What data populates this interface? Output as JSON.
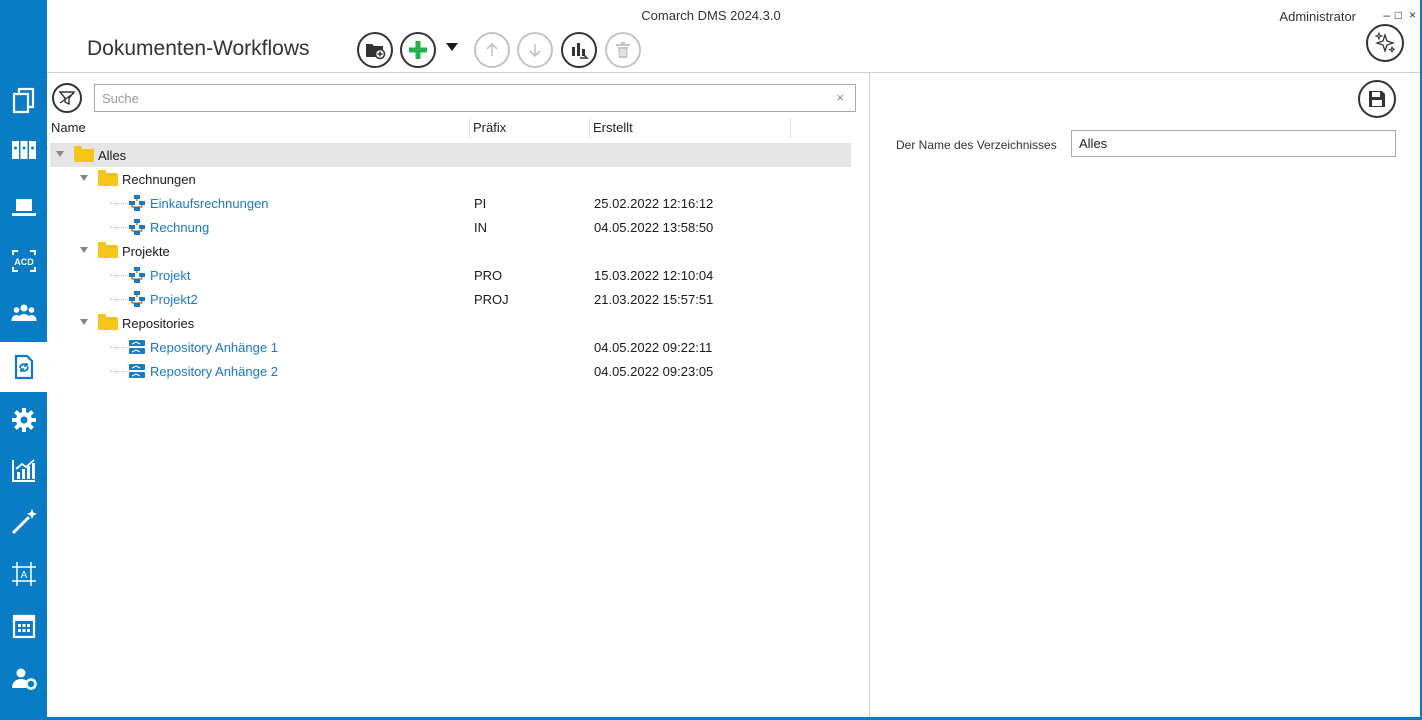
{
  "window": {
    "app_title": "Comarch DMS 2024.3.0",
    "user": "Administrator",
    "minimize": "–",
    "maximize": "□",
    "close": "×"
  },
  "page": {
    "title": "Dokumenten-Workflows"
  },
  "toolbar": {
    "buttons": [
      {
        "icon": "add-folder-icon",
        "enabled": true
      },
      {
        "icon": "plus-icon",
        "enabled": true
      },
      {
        "icon": "arrow-up-icon",
        "enabled": false
      },
      {
        "icon": "arrow-down-icon",
        "enabled": false
      },
      {
        "icon": "sort-icon",
        "enabled": true
      },
      {
        "icon": "trash-icon",
        "enabled": false
      }
    ]
  },
  "search": {
    "placeholder": "Suche",
    "value": "",
    "clear": "×"
  },
  "columns": {
    "name": "Name",
    "prefix": "Präfix",
    "created": "Erstellt"
  },
  "tree": [
    {
      "name": "Alles",
      "type": "folder",
      "level": 0,
      "prefix": "",
      "created": "",
      "selected": true
    },
    {
      "name": "Rechnungen",
      "type": "folder",
      "level": 1,
      "prefix": "",
      "created": ""
    },
    {
      "name": "Einkaufsrechnungen",
      "type": "workflow",
      "level": 2,
      "prefix": "PI",
      "created": "25.02.2022 12:16:12"
    },
    {
      "name": "Rechnung",
      "type": "workflow",
      "level": 2,
      "prefix": "IN",
      "created": "04.05.2022 13:58:50"
    },
    {
      "name": "Projekte",
      "type": "folder",
      "level": 1,
      "prefix": "",
      "created": ""
    },
    {
      "name": "Projekt",
      "type": "workflow",
      "level": 2,
      "prefix": "PRO",
      "created": "15.03.2022 12:10:04"
    },
    {
      "name": "Projekt2",
      "type": "workflow",
      "level": 2,
      "prefix": "PROJ",
      "created": "21.03.2022 15:57:51"
    },
    {
      "name": "Repositories",
      "type": "folder",
      "level": 1,
      "prefix": "",
      "created": ""
    },
    {
      "name": "Repository Anhänge 1",
      "type": "repository",
      "level": 2,
      "prefix": "",
      "created": "04.05.2022 09:22:11"
    },
    {
      "name": "Repository Anhänge 2",
      "type": "repository",
      "level": 2,
      "prefix": "",
      "created": "04.05.2022 09:23:05"
    }
  ],
  "details": {
    "label": "Der Name des Verzeichnisses",
    "value": "Alles"
  },
  "colors": {
    "accent": "#0a7cc5",
    "link": "#1a7ac4",
    "folder": "#f5c518",
    "plus": "#22b14c"
  },
  "nav": [
    {
      "icon": "documents-icon"
    },
    {
      "icon": "binders-icon"
    },
    {
      "icon": "laptop-icon"
    },
    {
      "icon": "acd-icon",
      "text": "ACD"
    },
    {
      "icon": "users-icon"
    },
    {
      "icon": "document-workflow-icon",
      "active": true
    },
    {
      "icon": "gear-icon"
    },
    {
      "icon": "chart-icon"
    },
    {
      "icon": "magic-wand-icon"
    },
    {
      "icon": "text-frame-icon",
      "text": "A"
    },
    {
      "icon": "calculator-icon"
    },
    {
      "icon": "user-settings-icon"
    },
    {
      "icon": "partial-icon"
    }
  ]
}
